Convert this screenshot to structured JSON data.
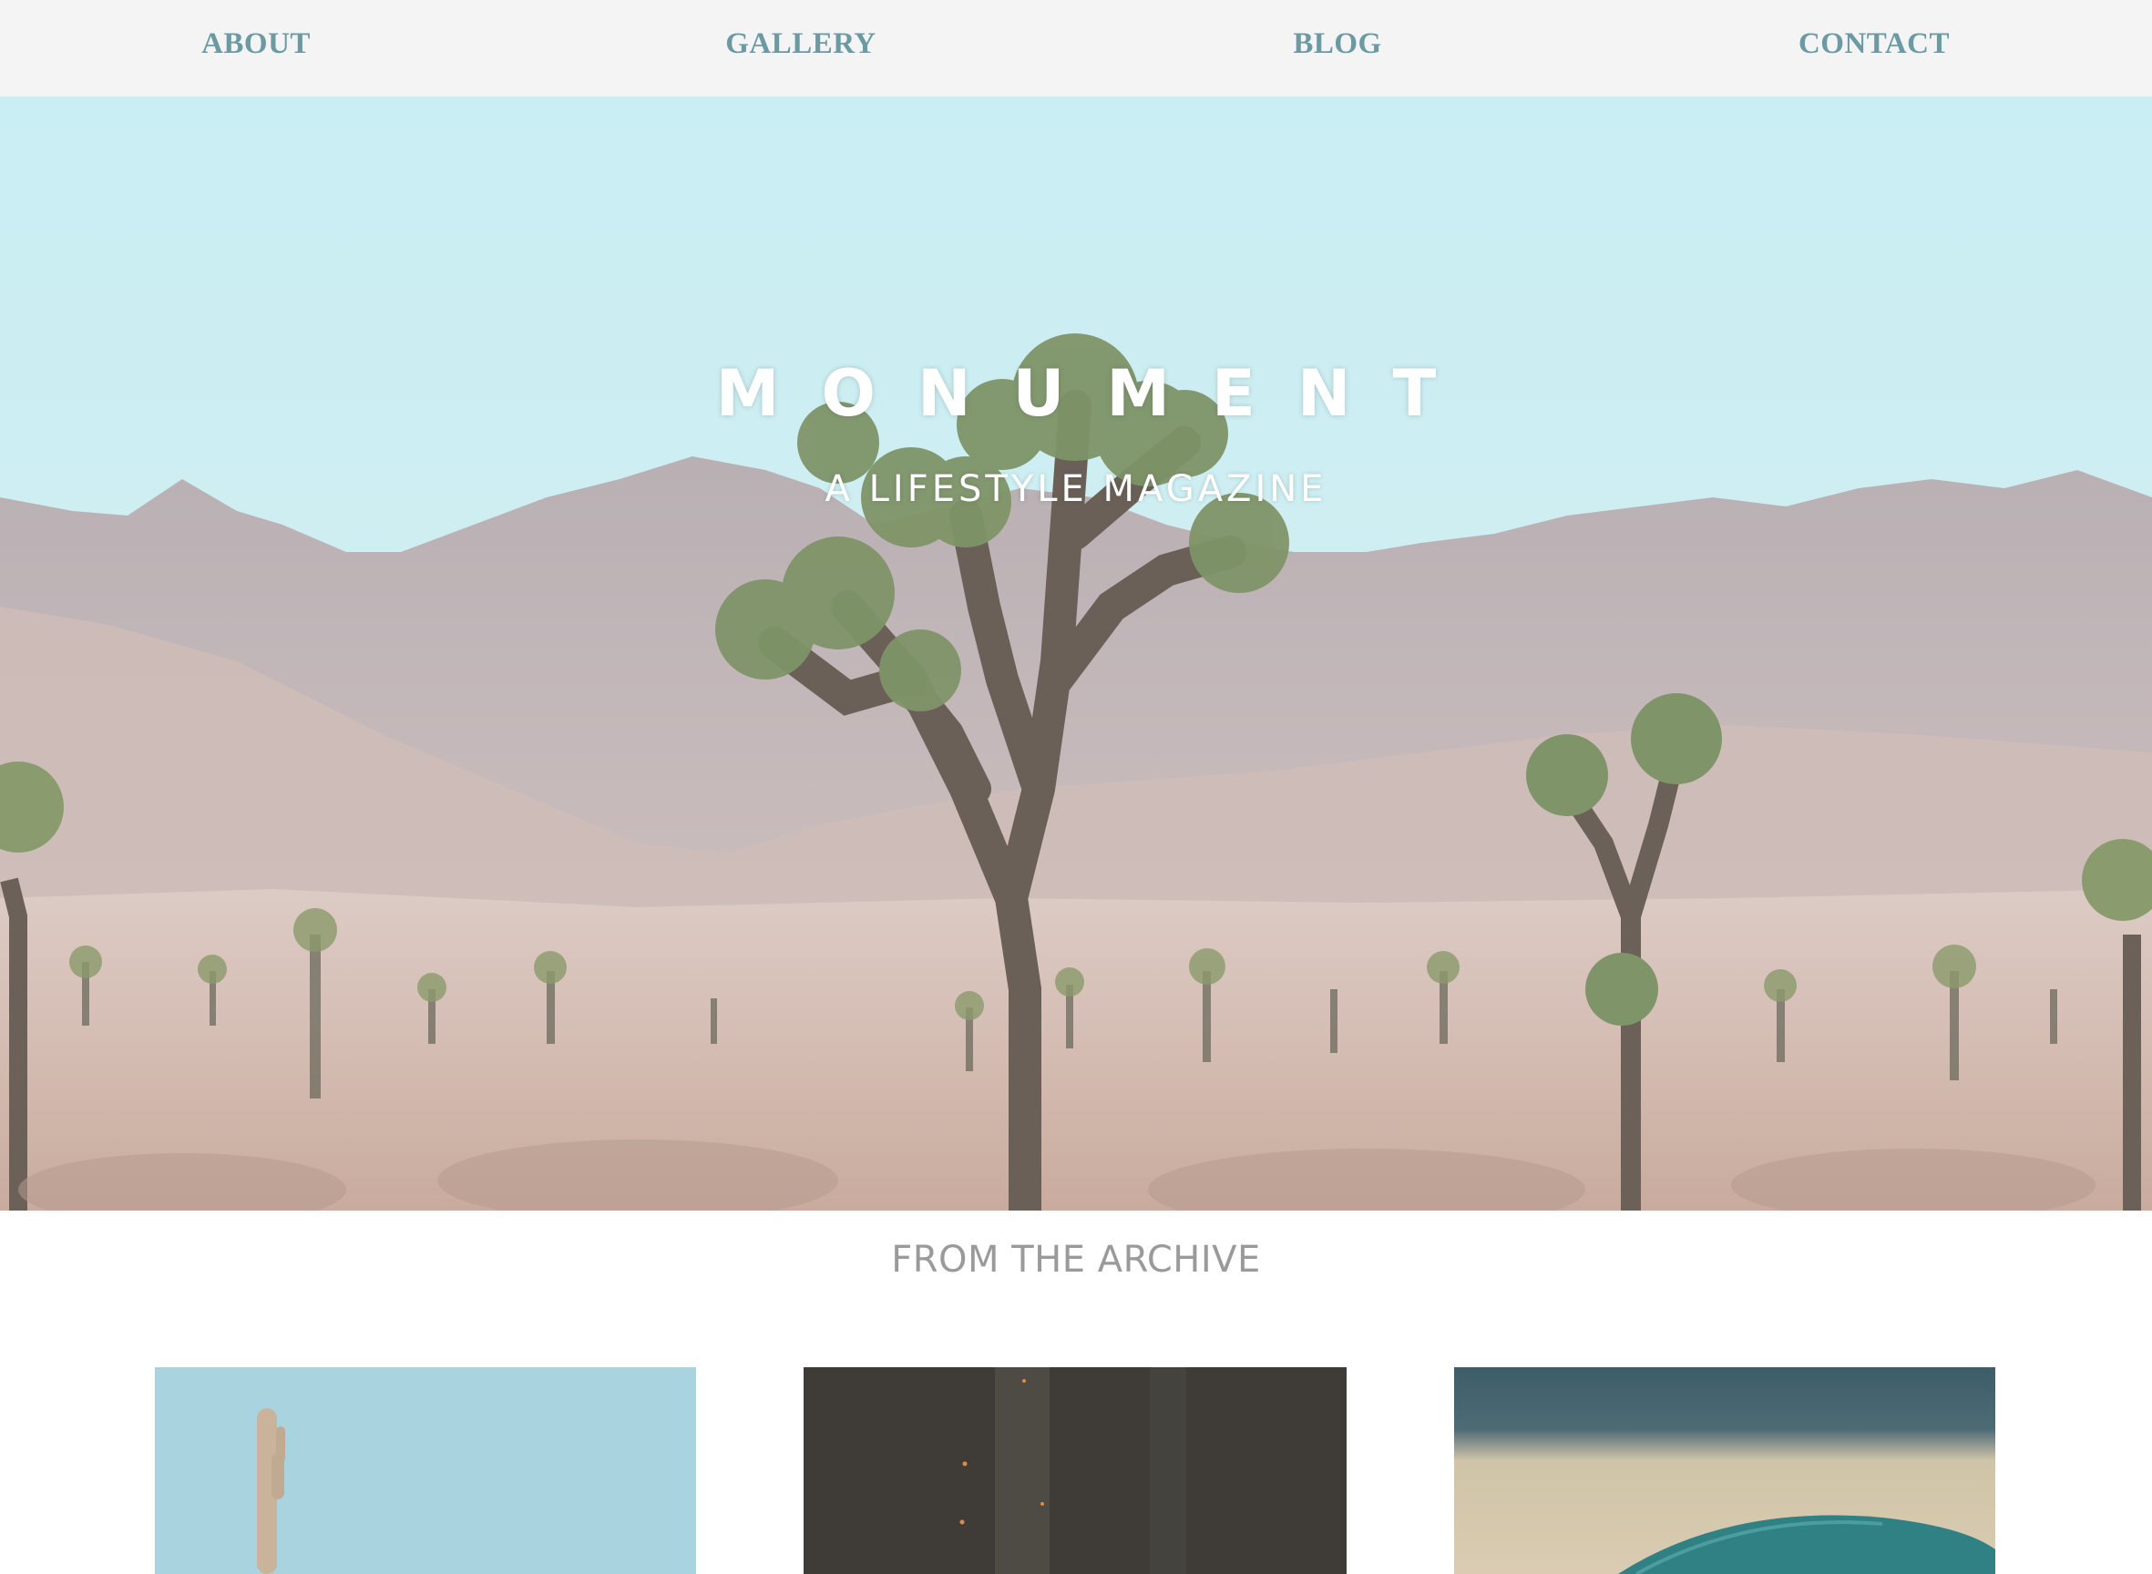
{
  "nav": {
    "items": [
      {
        "label": "ABOUT"
      },
      {
        "label": "GALLERY"
      },
      {
        "label": "BLOG"
      },
      {
        "label": "CONTACT"
      }
    ]
  },
  "hero": {
    "title": "MONUMENT",
    "subtitle": "A LIFESTYLE MAGAZINE"
  },
  "archive": {
    "heading": "FROM THE ARCHIVE",
    "cards": [
      {
        "image": "saguaro-cactus-sky"
      },
      {
        "image": "dark-forest-sparks"
      },
      {
        "image": "teal-car-roof-road"
      }
    ]
  },
  "colors": {
    "nav_background": "#f4f4f4",
    "nav_link": "#6b9aa3",
    "archive_heading": "#9a9a9a",
    "sky": "#c8eef3"
  }
}
